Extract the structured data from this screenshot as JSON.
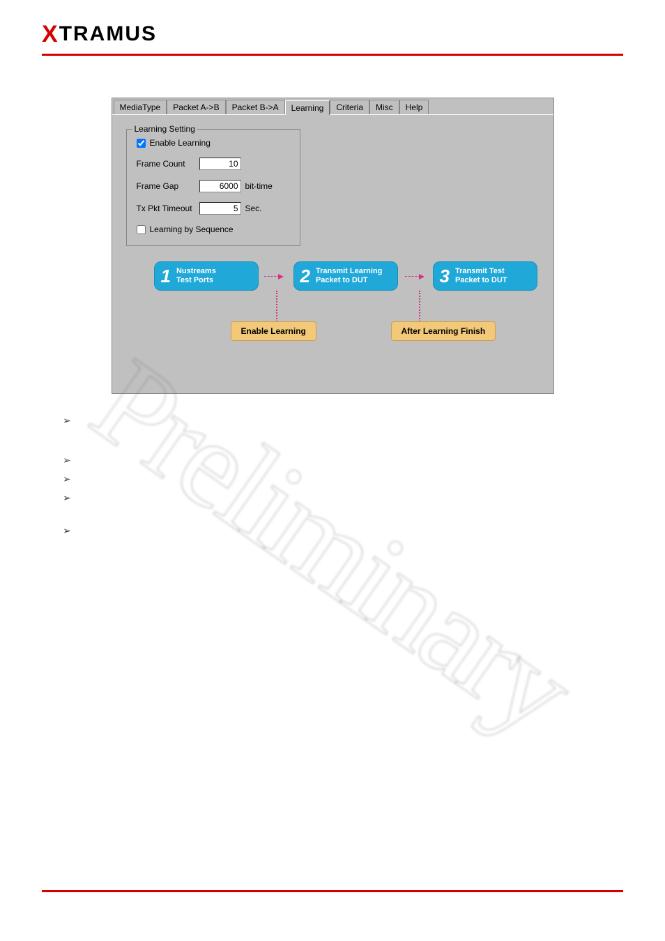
{
  "logo": {
    "x": "X",
    "rest": "TRAMUS"
  },
  "tabs": [
    "MediaType",
    "Packet A->B",
    "Packet B->A",
    "Learning",
    "Criteria",
    "Misc",
    "Help"
  ],
  "active_tab_index": 3,
  "fieldset": {
    "legend": "Learning Setting",
    "enable_learning": {
      "label": "Enable Learning",
      "checked": true
    },
    "frame_count": {
      "label": "Frame Count",
      "value": "10"
    },
    "frame_gap": {
      "label": "Frame Gap",
      "value": "6000",
      "unit": "bit-time"
    },
    "tx_pkt_timeout": {
      "label": "Tx Pkt Timeout",
      "value": "5",
      "unit": "Sec."
    },
    "learning_by_sequence": {
      "label": "Learning by Sequence",
      "checked": false
    }
  },
  "flow": {
    "step1": {
      "num": "1",
      "line1": "Nustreams",
      "line2": "Test Ports"
    },
    "step2": {
      "num": "2",
      "line1": "Transmit Learning",
      "line2": "Packet to DUT"
    },
    "step3": {
      "num": "3",
      "line1": "Transmit Test",
      "line2": "Packet to DUT"
    },
    "label1": "Enable Learning",
    "label2": "After Learning Finish"
  },
  "watermark": "Preliminary"
}
